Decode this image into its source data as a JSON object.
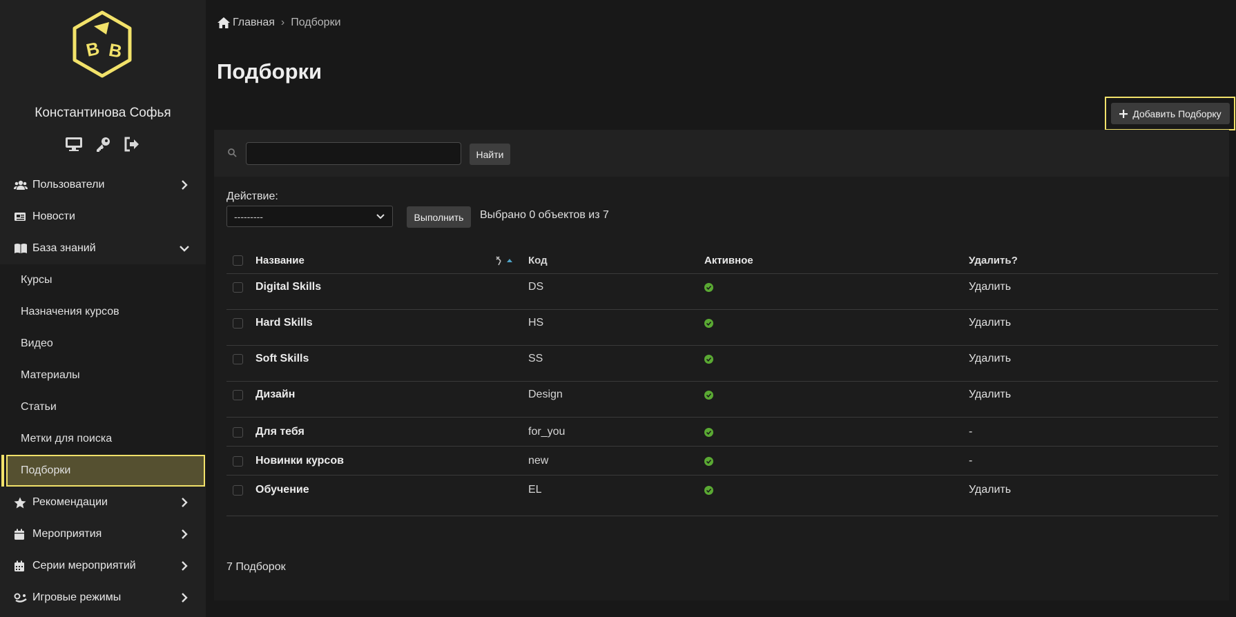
{
  "user": {
    "name": "Константинова Софья"
  },
  "icons": {
    "logo": "cube-logo",
    "user_actions": [
      "monitor-icon",
      "key-icon",
      "logout-icon"
    ]
  },
  "sidebar": {
    "items": [
      {
        "label": "Пользователи",
        "icon": "users-icon",
        "chevron": "right"
      },
      {
        "label": "Новости",
        "icon": "newspaper-icon",
        "chevron": ""
      },
      {
        "label": "База знаний",
        "icon": "book-icon",
        "chevron": "down"
      }
    ],
    "sub_items": [
      {
        "label": "Курсы"
      },
      {
        "label": "Назначения курсов"
      },
      {
        "label": "Видео"
      },
      {
        "label": "Материалы"
      },
      {
        "label": "Статьи"
      },
      {
        "label": "Метки для поиска"
      },
      {
        "label": "Подборки",
        "active": true
      }
    ],
    "items_after": [
      {
        "label": "Рекомендации",
        "icon": "star-icon"
      },
      {
        "label": "Мероприятия",
        "icon": "calendar-icon"
      },
      {
        "label": "Серии мероприятий",
        "icon": "calendar-grid-icon"
      },
      {
        "label": "Игровые режимы",
        "icon": "gamepad-icon"
      }
    ]
  },
  "breadcrumb": {
    "home": "Главная",
    "separator": "›",
    "current": "Подборки"
  },
  "page": {
    "title": "Подборки"
  },
  "add_button": {
    "label": "Добавить Подборку",
    "icon": "plus-icon"
  },
  "search": {
    "value": "",
    "placeholder": "",
    "button": "Найти"
  },
  "actions": {
    "label": "Действие:",
    "selected": "---------",
    "run_button": "Выполнить",
    "selection_text": "Выбрано 0 объектов из 7"
  },
  "table": {
    "columns": {
      "name": "Название",
      "code": "Код",
      "active": "Активное",
      "delete": "Удалить?"
    },
    "rows": [
      {
        "name": "Digital Skills",
        "code": "DS",
        "active": true,
        "delete": "Удалить"
      },
      {
        "name": "Hard Skills",
        "code": "HS",
        "active": true,
        "delete": "Удалить"
      },
      {
        "name": "Soft Skills",
        "code": "SS",
        "active": true,
        "delete": "Удалить"
      },
      {
        "name": "Дизайн",
        "code": "Design",
        "active": true,
        "delete": "Удалить"
      },
      {
        "name": "Для тебя",
        "code": "for_you",
        "active": true,
        "delete": "-"
      },
      {
        "name": "Новинки курсов",
        "code": "new",
        "active": true,
        "delete": "-"
      },
      {
        "name": "Обучение",
        "code": "EL",
        "active": true,
        "delete": "Удалить"
      }
    ]
  },
  "footer": {
    "count": "7 Подборок"
  },
  "colors": {
    "accent": "#f2e26a",
    "active_bg": "#555030",
    "ok": "#5aa933",
    "annotation_arrow": "#d8304a"
  }
}
